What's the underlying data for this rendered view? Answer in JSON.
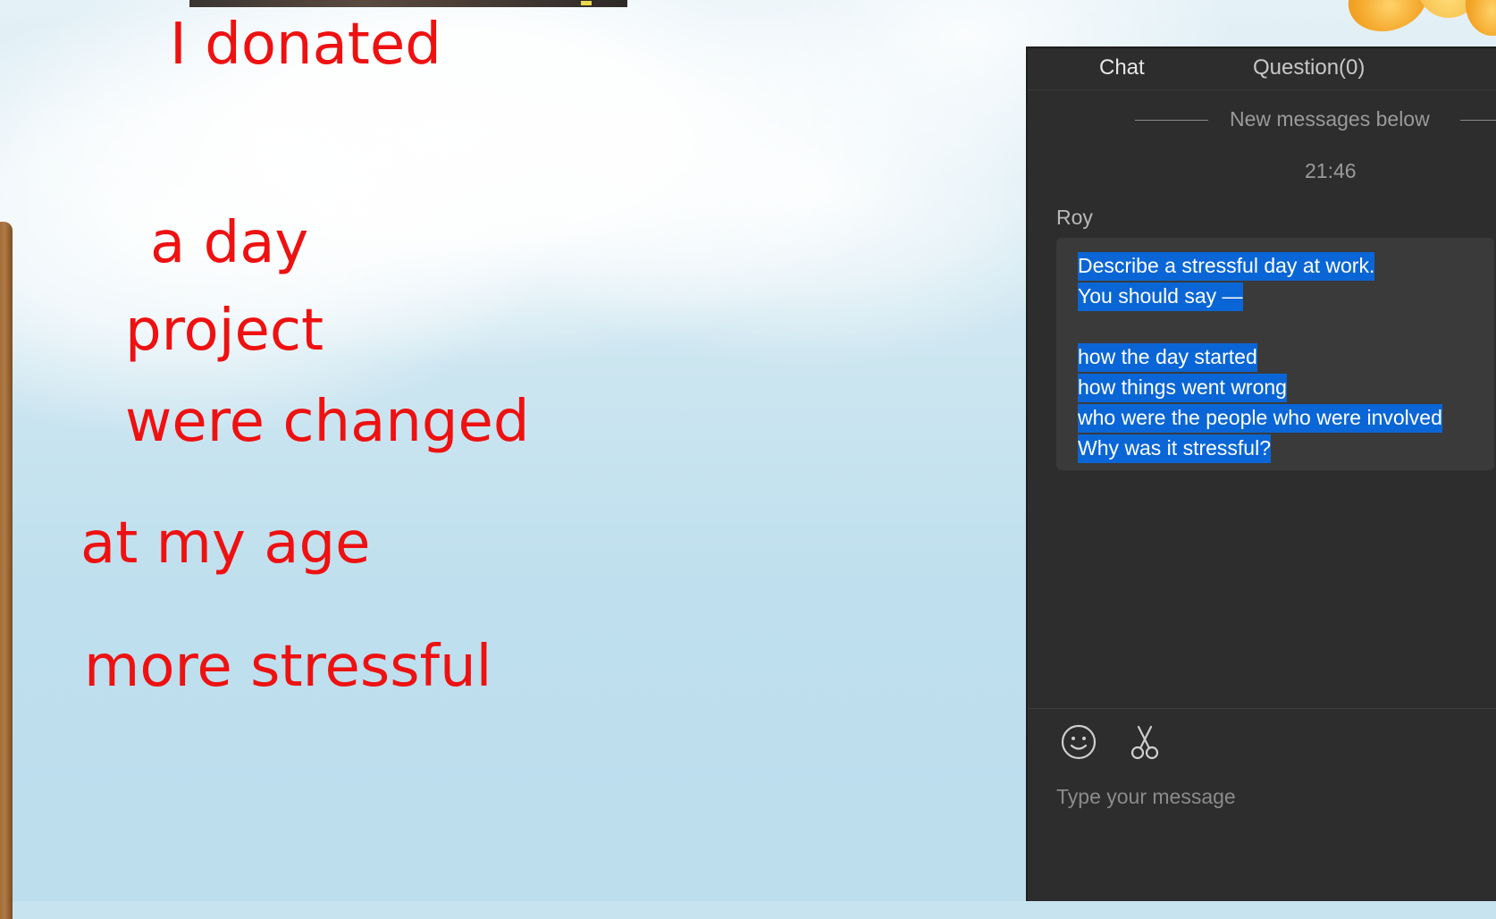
{
  "background": {
    "annotations": [
      "I donated",
      "a day",
      "project",
      "were changed",
      "at my age",
      "more stressful"
    ],
    "annotation_color": "#ee1111"
  },
  "chat": {
    "tabs": [
      {
        "label": "Chat",
        "active": true
      },
      {
        "label": "Question(0)",
        "active": false
      }
    ],
    "divider_text": "New messages below",
    "timestamp": "21:46",
    "message": {
      "sender": "Roy",
      "lines": [
        "Describe a stressful day at work.",
        "You should say —",
        "",
        "how the day started",
        "how things went wrong",
        "who were the people who were involved",
        "Why was it stressful?"
      ],
      "selection_color": "#0a66d6"
    },
    "input": {
      "placeholder": "Type your message",
      "value": ""
    },
    "toolbar": {
      "icons": [
        "emoji-icon",
        "scissors-icon"
      ]
    },
    "colors": {
      "panel_bg": "#2d2d2d",
      "bubble_bg": "#3a3a3a"
    }
  }
}
